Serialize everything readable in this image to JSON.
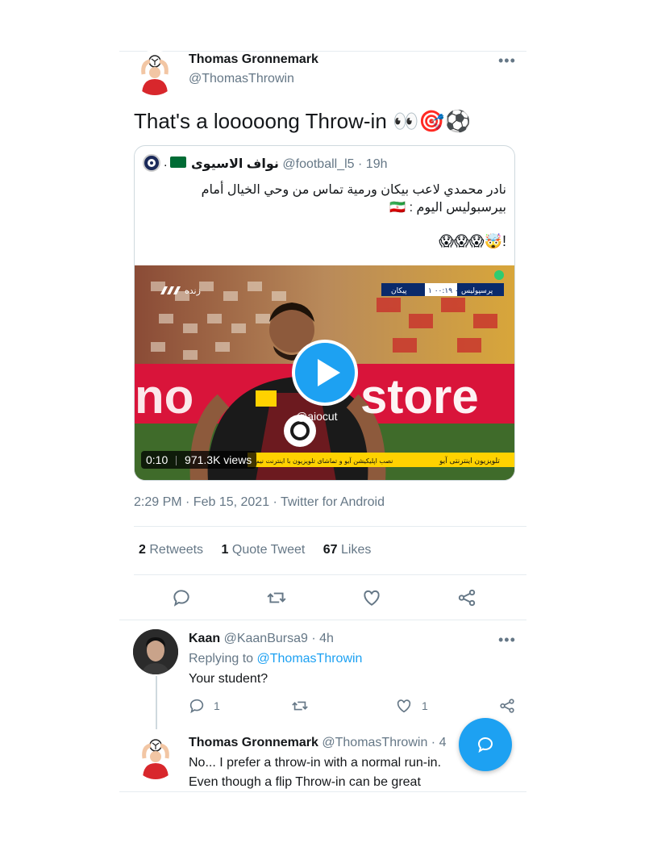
{
  "tweet": {
    "author_name": "Thomas Gronnemark",
    "author_handle": "@ThomasThrowin",
    "text": "That's a looooong Throw-in 👀🎯⚽",
    "timestamp": "2:29 PM · Feb 15, 2021 · Twitter for Android",
    "stats": {
      "retweets_count": "2",
      "retweets_label": "Retweets",
      "quotes_count": "1",
      "quotes_label": "Quote Tweet",
      "likes_count": "67",
      "likes_label": "Likes"
    }
  },
  "quoted": {
    "author_name": "نواف الاسيوى",
    "author_handle": "@football_l5",
    "age": "· 19h",
    "text": "نادر محمدي لاعب بيكان ورمية تماس من وحي الخيال أمام بيرسبوليس اليوم : 🇮🇷",
    "emoji_line": "!🤯😱😱😱",
    "video": {
      "duration": "0:10",
      "views": "971.3K views",
      "watermark": "@aiocut",
      "live_label": "زنده",
      "score_left_team": "پرسپولیس",
      "score_value": "۱ ۰۰:۱۹ ۰",
      "score_right_team": "پیکان",
      "banner_text": "store",
      "ticker_left": "نصب اپلیکیشن آیو و تماشای تلویزیون با اینترنت نیم",
      "ticker_right": "تلویزیون اینترنتی آیو"
    }
  },
  "replies": [
    {
      "author_name": "Kaan",
      "author_handle": "@KaanBursa9",
      "age": "· 4h",
      "replying_prefix": "Replying to",
      "replying_to": "@ThomasThrowin",
      "text": "Your student?",
      "reply_count": "1",
      "like_count": "1"
    },
    {
      "author_name": "Thomas Gronnemark",
      "author_handle": "@ThomasThrowin",
      "age": "· 4",
      "text_line1": "No... I prefer a throw-in with a normal run-in.",
      "text_line2": "Even though a flip Throw-in can be great"
    }
  ],
  "icons": {
    "more": "more-icon",
    "reply": "reply-icon",
    "retweet": "retweet-icon",
    "like": "heart-icon",
    "share": "share-icon",
    "compose": "compose-icon",
    "play": "play-icon"
  },
  "colors": {
    "accent": "#1da1f2",
    "secondary_text": "#657786",
    "divider": "#e6ecf0"
  }
}
